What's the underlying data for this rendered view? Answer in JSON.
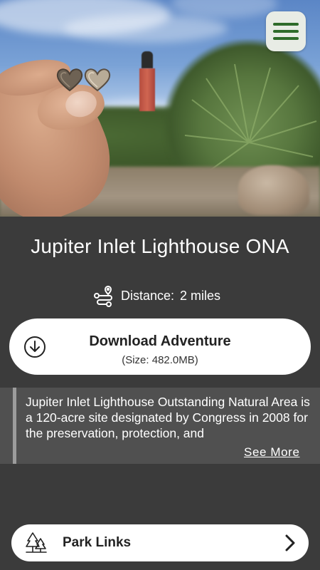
{
  "hero": {
    "menu_icon": "hamburger-menu-icon",
    "accent_color": "#2e6b2a"
  },
  "park": {
    "title": "Jupiter Inlet Lighthouse ONA",
    "distance_label": "Distance:",
    "distance_value": "2 miles",
    "distance_icon": "route-icon"
  },
  "download": {
    "title": "Download Adventure",
    "size": "(Size: 482.0MB)",
    "icon": "download-circle-icon"
  },
  "description": {
    "text": "Jupiter Inlet Lighthouse Outstanding Natural Area is a 120-acre site designated by Congress in 2008 for the preservation, protection, and",
    "see_more": "See More"
  },
  "park_links": {
    "label": "Park Links",
    "icon": "trees-icon",
    "chevron": "chevron-right-icon"
  }
}
